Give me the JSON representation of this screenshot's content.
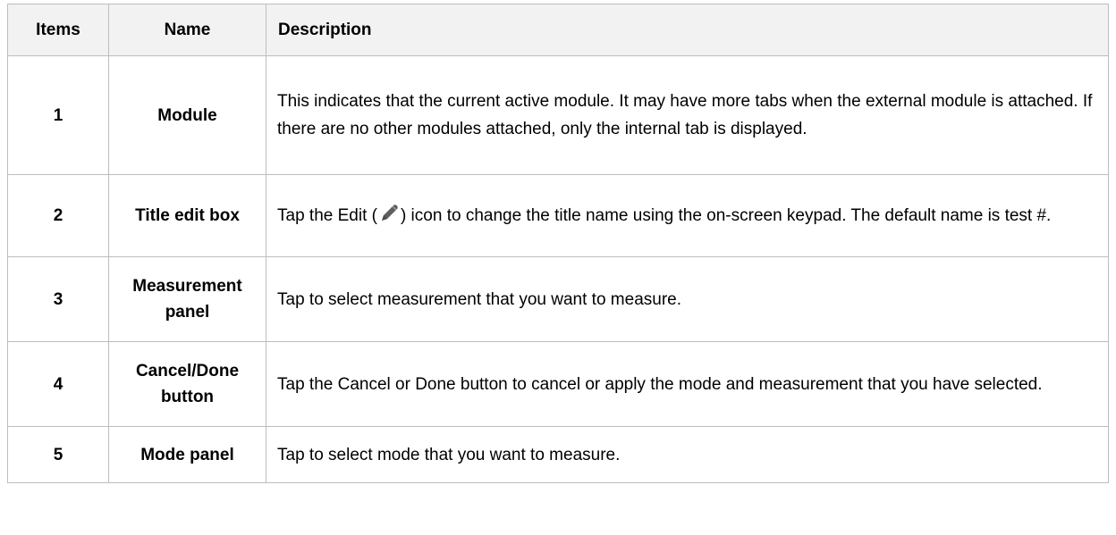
{
  "headers": {
    "items": "Items",
    "name": "Name",
    "description": "Description"
  },
  "rows": [
    {
      "item": "1",
      "name": "Module",
      "description": "This indicates that the current active module. It may have more tabs when the external module is attached. If there are no other modules attached, only the internal tab is displayed."
    },
    {
      "item": "2",
      "name": "Title edit box",
      "description_before_icon": "Tap the Edit (",
      "description_icon": "pencil-icon",
      "description_after_icon": ") icon to change the title name using the on-screen keypad. The default name is test #."
    },
    {
      "item": "3",
      "name": "Measurement panel",
      "description": "Tap to select measurement that you want to measure."
    },
    {
      "item": "4",
      "name": "Cancel/Done button",
      "description": "Tap the Cancel or Done button  to cancel or apply the mode and measurement that you have selected."
    },
    {
      "item": "5",
      "name": "Mode panel",
      "description": "Tap to select mode that you want to measure."
    }
  ]
}
